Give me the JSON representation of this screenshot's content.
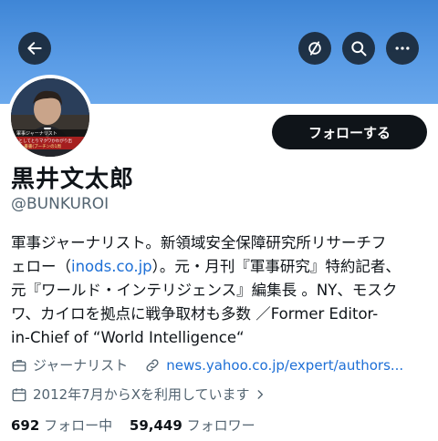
{
  "profile": {
    "name": "黒井文太郎",
    "handle": "@BUNKUROI",
    "follow_label": "フォローする",
    "avatar_caption_1": "軍事ジャーナリスト",
    "avatar_caption_2": "ンとしてとりマクワかわがり出",
    "avatar_caption_3": "ある 書書(プーチンの1周"
  },
  "bio": {
    "line1": "軍事ジャーナリスト。新領域安全保障研究所リサーチフ",
    "line2_pre": "ェロー（",
    "line2_link": "inods.co.jp",
    "line2_post": "）。元・月刊『軍事研究』特約記者、",
    "line3": "元『ワールド・インテリジェンス』編集長 。NY、モスク",
    "line4": "ワ、カイロを拠点に戦争取材も多数 ／Former Editor-",
    "line5": "in-Chief of “World Intelligence“"
  },
  "meta": {
    "category": "ジャーナリスト",
    "website": "news.yahoo.co.jp/expert/authors...",
    "joined": "2012年7月からXを利用しています",
    "icons": [
      "briefcase-icon",
      "link-icon",
      "calendar-icon",
      "chevron-right-icon"
    ]
  },
  "stats": {
    "following_count": "692",
    "following_label": "フォロー中",
    "followers_count": "59,449",
    "followers_label": "フォロワー"
  },
  "colors": {
    "banner": "#4a90e2",
    "button_dark": "#0f1419",
    "link": "#1d6fd6",
    "secondary_text": "#536471"
  }
}
